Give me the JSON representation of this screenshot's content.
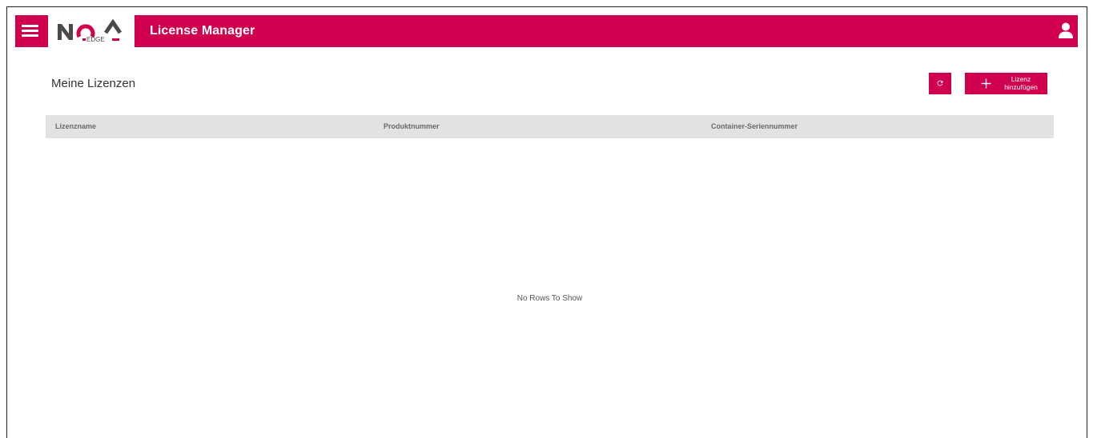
{
  "colors": {
    "brand": "#d1004f",
    "header_text": "#ffffff",
    "table_header_bg": "#e2e2e2"
  },
  "header": {
    "menu_icon": "hamburger-menu-icon",
    "logo": {
      "text": "NQA",
      "sub": "EDGE"
    },
    "title": "License Manager",
    "user_icon": "user-account-icon"
  },
  "page": {
    "title": "Meine Lizenzen"
  },
  "toolbar": {
    "refresh_icon": "refresh-icon",
    "add_icon": "plus-icon",
    "add_label_line1": "Lizenz",
    "add_label_line2": "hinzufügen"
  },
  "table": {
    "columns": [
      "Lizenzname",
      "Produktnummer",
      "Container-Seriennummer"
    ],
    "rows": [],
    "empty_text": "No Rows To Show"
  }
}
